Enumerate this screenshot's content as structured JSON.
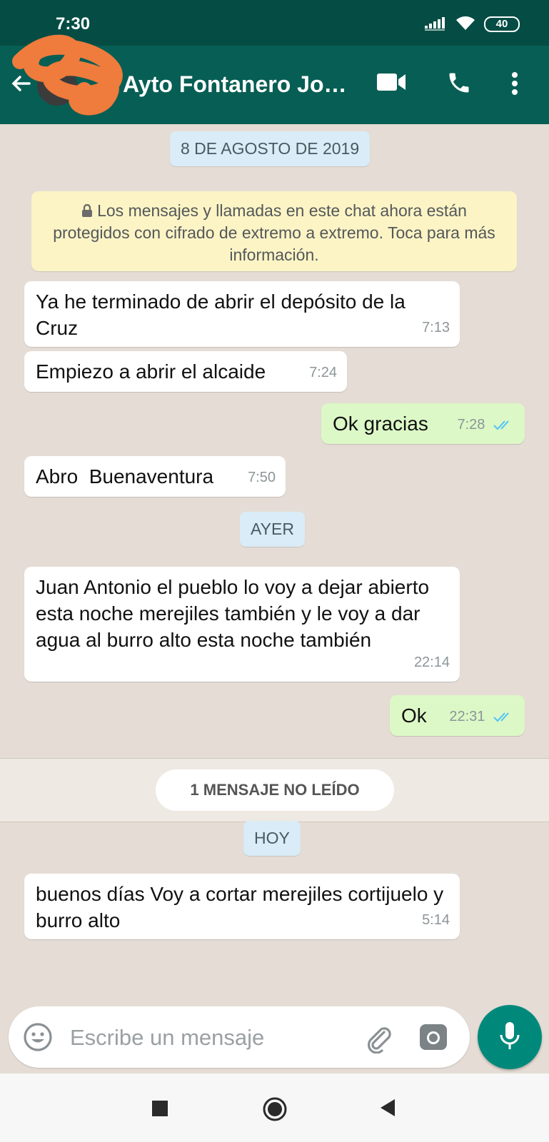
{
  "status_bar": {
    "time": "7:30",
    "battery": "40"
  },
  "header": {
    "contact_name": "Ayto Fontanero José..."
  },
  "chat": {
    "date_1": "8 DE AGOSTO DE 2019",
    "encryption_notice": "Los mensajes y llamadas en este chat ahora están protegidos con cifrado de extremo a extremo. Toca para más información.",
    "date_2": "AYER",
    "unread_banner": "1 MENSAJE NO LEÍDO",
    "date_3": "HOY",
    "messages": [
      {
        "text": "Ya he terminado de abrir el depósito de la Cruz",
        "time": "7:13"
      },
      {
        "text": "Empiezo a abrir el alcaide",
        "time": "7:24"
      },
      {
        "text": "Ok gracias",
        "time": "7:28"
      },
      {
        "text": "Abro  Buenaventura",
        "time": "7:50"
      },
      {
        "text": "Juan Antonio el pueblo lo voy a dejar abierto esta noche merejiles también y le voy a dar agua al burro alto esta noche también",
        "time": "22:14"
      },
      {
        "text": "Ok",
        "time": "22:31"
      },
      {
        "text": "buenos días Voy a cortar merejiles cortijuelo y burro alto",
        "time": "5:14"
      }
    ]
  },
  "composer": {
    "placeholder": "Escribe un mensaje"
  },
  "colors": {
    "header": "#075e54",
    "status_bar": "#054d44",
    "outgoing": "#dcf8c6",
    "incoming": "#ffffff",
    "accent": "#00897b",
    "read_ticks": "#4fc3f7"
  }
}
